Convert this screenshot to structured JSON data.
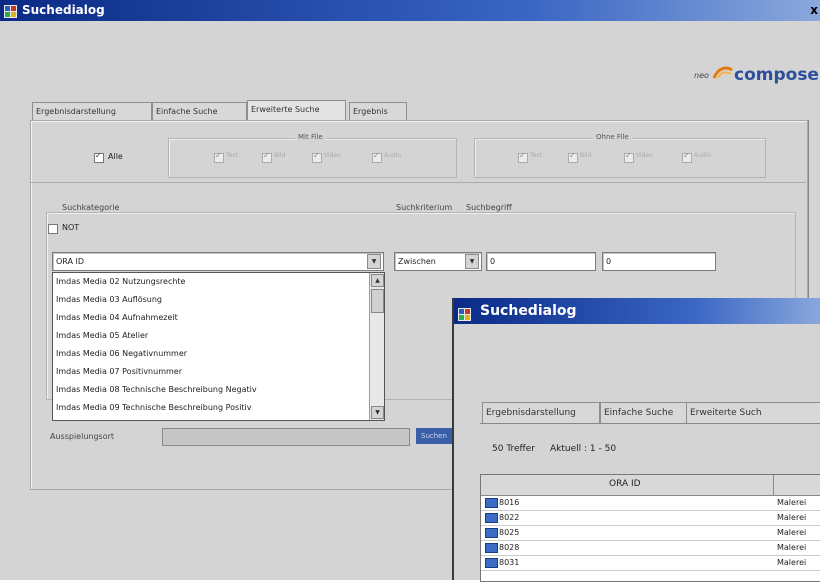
{
  "main_window": {
    "title": "Suchedialog",
    "close_label": "x",
    "logo": {
      "prefix": "neo",
      "name": "composer"
    },
    "tabs": [
      "Ergebnisdarstellung",
      "Einfache Suche",
      "Erweiterte Suche",
      "Ergebnis"
    ],
    "active_tab": "Erweiterte Suche",
    "alle": {
      "label": "Alle",
      "checked": true
    },
    "mit_file": {
      "label": "Mit File",
      "checkbox_labels": [
        "Text",
        "Bild",
        "Video",
        "Audio"
      ]
    },
    "ohne_file": {
      "label": "Ohne File",
      "checkbox_labels": [
        "Text",
        "Bild",
        "Video",
        "Audio"
      ]
    },
    "suchkategorie_label": "Suchkategorie",
    "suchkriterium_label": "Suchkriterium",
    "suchbegriff_label": "Suchbegriff",
    "not_label": "NOT",
    "category_value": "ORA ID",
    "criterion_value": "Zwischen",
    "term_from": "0",
    "term_to": "0",
    "category_options": [
      "Imdas Media 02 Nutzungsrechte",
      "Imdas Media 03 Auflösung",
      "Imdas Media 04 Aufnahmezeit",
      "Imdas Media 05 Atelier",
      "Imdas Media 06 Negativnummer",
      "Imdas Media 07 Positivnummer",
      "Imdas Media 08 Technische Beschreibung Negativ",
      "Imdas Media 09 Technische Beschreibung Positiv"
    ],
    "ausspielungsort_label": "Ausspielungsort",
    "ausspielungsort_button": "Suchen"
  },
  "second_window": {
    "title": "Suchedialog",
    "tabs": [
      "Ergebnisdarstellung",
      "Einfache Suche",
      "Erweiterte Such"
    ],
    "hits_label": "50 Treffer",
    "current_label": "Aktuell : 1 - 50",
    "columns": [
      "ORA ID",
      ""
    ],
    "rows": [
      {
        "id": "8016",
        "category": "Malerei"
      },
      {
        "id": "8022",
        "category": "Malerei"
      },
      {
        "id": "8025",
        "category": "Malerei"
      },
      {
        "id": "8028",
        "category": "Malerei"
      },
      {
        "id": "8031",
        "category": "Malerei"
      }
    ]
  },
  "colors": {
    "titlebar_start": "#0a2a86",
    "titlebar_end": "#8aa8dc",
    "window_bg": "#d4d4d4",
    "logo_orange": "#e8780a",
    "logo_blue": "#2b4f9c"
  }
}
